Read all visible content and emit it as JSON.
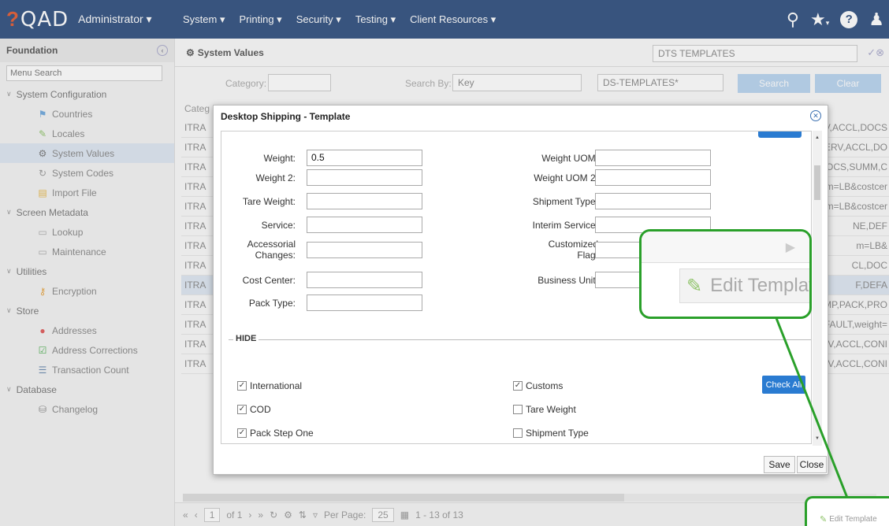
{
  "topbar": {
    "logo": "QAD",
    "user_menu": "Administrator ▾",
    "menu": [
      "System ▾",
      "Printing ▾",
      "Security ▾",
      "Testing ▾",
      "Client Resources ▾"
    ]
  },
  "sidebar": {
    "title": "Foundation",
    "search_placeholder": "Menu Search",
    "items": [
      {
        "type": "group",
        "label": "System Configuration"
      },
      {
        "type": "leaf",
        "label": "Countries",
        "icon": "flag-icon"
      },
      {
        "type": "leaf",
        "label": "Locales",
        "icon": "pencil-icon"
      },
      {
        "type": "leaf",
        "label": "System Values",
        "icon": "gear-icon",
        "selected": true
      },
      {
        "type": "leaf",
        "label": "System Codes",
        "icon": "codes-icon"
      },
      {
        "type": "leaf",
        "label": "Import File",
        "icon": "file-icon"
      },
      {
        "type": "group",
        "label": "Screen Metadata"
      },
      {
        "type": "leaf",
        "label": "Lookup",
        "icon": "window-icon"
      },
      {
        "type": "leaf",
        "label": "Maintenance",
        "icon": "window-icon"
      },
      {
        "type": "group",
        "label": "Utilities"
      },
      {
        "type": "leaf",
        "label": "Encryption",
        "icon": "key-icon"
      },
      {
        "type": "group",
        "label": "Store"
      },
      {
        "type": "leaf",
        "label": "Addresses",
        "icon": "pin-icon"
      },
      {
        "type": "leaf",
        "label": "Address Corrections",
        "icon": "check-icon"
      },
      {
        "type": "leaf",
        "label": "Transaction Count",
        "icon": "list-icon"
      },
      {
        "type": "group",
        "label": "Database"
      },
      {
        "type": "leaf",
        "label": "Changelog",
        "icon": "database-icon"
      }
    ]
  },
  "main": {
    "title": "System Values",
    "dts_select": "DTS TEMPLATES",
    "category_label": "Category:",
    "search_by_label": "Search By:",
    "search_by_value": "Key",
    "search_value": "DS-TEMPLATES*",
    "search_button": "Search",
    "clear_button": "Clear",
    "table_head": "Categ",
    "rows": [
      {
        "c1": "ITRA",
        "c2": "RV,ACCL,DOCS"
      },
      {
        "c1": "ITRA",
        "c2": "SERV,ACCL,DO"
      },
      {
        "c1": "ITRA",
        "c2": "DOCS,SUMM,C"
      },
      {
        "c1": "ITRA",
        "c2": "m=LB&costcer"
      },
      {
        "c1": "ITRA",
        "c2": "m=LB&costcer"
      },
      {
        "c1": "ITRA",
        "c2": "NE,DEF"
      },
      {
        "c1": "ITRA",
        "c2": "m=LB&"
      },
      {
        "c1": "ITRA",
        "c2": "CL,DOC"
      },
      {
        "c1": "ITRA",
        "c2": "F,DEFA"
      },
      {
        "c1": "ITRA",
        "c2": "MP,PACK,PRO"
      },
      {
        "c1": "ITRA",
        "c2": "FAULT,weight="
      },
      {
        "c1": "ITRA",
        "c2": "RV,ACCL,CONI"
      },
      {
        "c1": "ITRA",
        "c2": "RV,ACCL,CONI"
      }
    ],
    "pager": {
      "page": "1",
      "of": "of 1",
      "per_page_label": "Per Page:",
      "per_page": "25",
      "range": "1 - 13 of 13"
    }
  },
  "dialog": {
    "title": "Desktop Shipping - Template",
    "fields_left": [
      {
        "label": "Weight:",
        "value": "0.5"
      },
      {
        "label": "Weight 2:",
        "value": ""
      },
      {
        "label": "Tare Weight:",
        "value": ""
      },
      {
        "label": "Service:",
        "value": ""
      },
      {
        "label": "Accessorial\nChanges:",
        "value": ""
      },
      {
        "label": "Cost Center:",
        "value": ""
      },
      {
        "label": "Pack Type:",
        "value": ""
      }
    ],
    "fields_right": [
      {
        "label": "Weight UOM:",
        "value": ""
      },
      {
        "label": "Weight UOM 2:",
        "value": ""
      },
      {
        "label": "Shipment Type:",
        "value": ""
      },
      {
        "label": "Interim Service:",
        "value": ""
      },
      {
        "label": "Customized\nFlag:",
        "value": ""
      },
      {
        "label": "Business Unit:",
        "value": ""
      }
    ],
    "hide_label": "HIDE",
    "check_all": "Check All",
    "checks_left": [
      {
        "label": "International",
        "checked": true
      },
      {
        "label": "COD",
        "checked": true
      },
      {
        "label": "Pack Step One",
        "checked": true
      }
    ],
    "checks_right": [
      {
        "label": "Customs",
        "checked": true
      },
      {
        "label": "Tare Weight",
        "checked": false
      },
      {
        "label": "Shipment Type",
        "checked": false
      }
    ],
    "save": "Save",
    "close": "Close"
  },
  "callout": {
    "edit_template": "Edit Template",
    "small_edit_template": "Edit Template"
  },
  "colors": {
    "topbar": "#2f4f7f",
    "accent": "#2a7bd1",
    "callout": "#2aa02a"
  }
}
